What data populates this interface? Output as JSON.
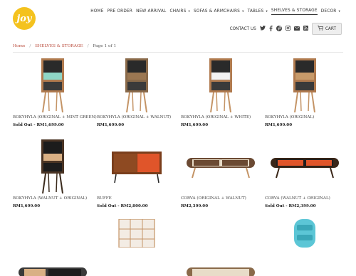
{
  "brand": {
    "logo_text": "joy"
  },
  "nav": {
    "items": [
      {
        "label": "HOME",
        "caret": ""
      },
      {
        "label": "PRE ORDER",
        "caret": ""
      },
      {
        "label": "NEW ARRIVAL",
        "caret": ""
      },
      {
        "label": "CHAIRS",
        "caret": "▾"
      },
      {
        "label": "SOFAS & ARMCHAIRS",
        "caret": "▾"
      },
      {
        "label": "TABLES",
        "caret": "▾"
      },
      {
        "label": "SHELVES & STORAGE",
        "caret": ""
      },
      {
        "label": "DECOR",
        "caret": "▾"
      }
    ]
  },
  "utility": {
    "contact_label": "CONTACT US",
    "icons": [
      "twitter-icon",
      "facebook-icon",
      "pinterest-icon",
      "instagram-icon",
      "mail-icon",
      "rss-icon"
    ],
    "cart_label": "CART"
  },
  "breadcrumb": {
    "home": "Home",
    "section": "SHELVES & STORAGE",
    "page": "Page 1 of 1"
  },
  "products": [
    {
      "name": "BOKYHYLA (ORIGINAL + MINT GREEN)",
      "price": "Sold Out - RM1,699.00",
      "accent": "#8fd6c6",
      "kind": "cabinet"
    },
    {
      "name": "BOKYHYLA (ORIGINAL + WALNUT)",
      "price": "RM1,699.00",
      "accent": "#8a6a4a",
      "kind": "cabinet"
    },
    {
      "name": "BOKYHYLA (ORIGINAL + WHITE)",
      "price": "RM1,699.00",
      "accent": "#f2f2f2",
      "kind": "cabinet"
    },
    {
      "name": "BOKYHYLA (ORIGINAL)",
      "price": "RM1,699.00",
      "accent": "#c79a6a",
      "kind": "cabinet"
    },
    {
      "name": "BOKYHYLA (WALNUT + ORIGINAL)",
      "price": "RM1,699.00",
      "accent": "#d9b084",
      "kind": "cabinet-dark"
    },
    {
      "name": "BUFFE",
      "price": "Sold Out - RM2,800.00",
      "accent": "#e0552a",
      "kind": "buffet"
    },
    {
      "name": "CORVA (ORIGINAL + WALNUT)",
      "price": "RM2,399.00",
      "accent": "#6b4a33",
      "kind": "tv"
    },
    {
      "name": "CORVA (WALNUT + ORIGINAL)",
      "price": "Sold Out - RM2,399.00",
      "accent": "#e0552a",
      "kind": "tv-orange"
    }
  ]
}
